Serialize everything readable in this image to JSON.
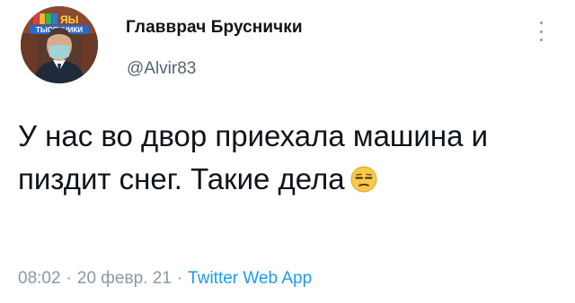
{
  "user": {
    "display_name": "Главврач Бруснички",
    "handle": "@Alvir83",
    "avatar_overlay_text": [
      "ЯЫ",
      "ТЫСЯЧНИКИ"
    ]
  },
  "tweet": {
    "text": "У нас во двор приехала машина и пиздит снег. Такие дела",
    "emoji": "unamused-face"
  },
  "meta": {
    "time": "08:02",
    "date": "20 февр. 21",
    "separator": "·",
    "source": "Twitter Web App"
  },
  "colors": {
    "text": "#0f1419",
    "secondary": "#536471",
    "link": "#1d9bf0",
    "emoji": "#f7c948"
  },
  "icons": {
    "more": "more-vertical-icon"
  }
}
